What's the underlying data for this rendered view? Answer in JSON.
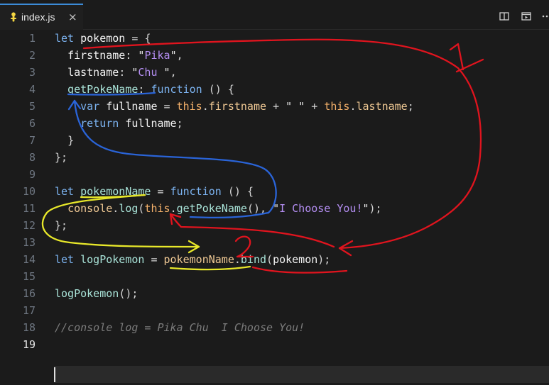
{
  "tab": {
    "filename": "index.js",
    "close": "×",
    "icon": "javascript-file-icon"
  },
  "actions": [
    {
      "icon": "split-editor-icon"
    },
    {
      "icon": "open-preview-icon"
    },
    {
      "icon": "more-actions-icon"
    }
  ],
  "gutter": {
    "lines": [
      "1",
      "2",
      "3",
      "4",
      "5",
      "6",
      "7",
      "8",
      "9",
      "10",
      "11",
      "12",
      "13",
      "14",
      "15",
      "16",
      "17",
      "18",
      "19"
    ],
    "active_line": "19"
  },
  "code": {
    "l1": [
      "let",
      "pokemon",
      "=",
      "{"
    ],
    "l2": [
      "firstname",
      ":",
      "\"",
      "Pika",
      "\"",
      ","
    ],
    "l3": [
      "lastname",
      ":",
      "\"",
      "Chu ",
      "\"",
      ","
    ],
    "l4": [
      "getPokeName",
      ":",
      "function",
      "()",
      "{"
    ],
    "l5": [
      "var",
      "fullname",
      "=",
      "this",
      ".",
      "firstname",
      "+",
      "\" \"",
      "+",
      "this",
      ".",
      "lastname",
      ";"
    ],
    "l6": [
      "return",
      "fullname",
      ";"
    ],
    "l7": [
      "}"
    ],
    "l8": [
      "};"
    ],
    "l10": [
      "let",
      "pokemonName",
      "=",
      "function",
      "()",
      "{"
    ],
    "l11": [
      "console",
      ".",
      "log",
      "(",
      "this",
      ".",
      "getPokeName",
      "()",
      ",",
      "\"",
      "I Choose You!",
      "\"",
      ");"
    ],
    "l12": [
      "};"
    ],
    "l14": [
      "let",
      "logPokemon",
      "=",
      "pokemonName",
      ".",
      "bind",
      "(",
      "pokemon",
      ");"
    ],
    "l16": [
      "logPokemon",
      "();"
    ],
    "l18": [
      "//console log = Pika Chu  I Choose You!"
    ]
  },
  "annotations": {
    "label_1": "1",
    "label_2": "2"
  },
  "colors": {
    "red": "#e0141e",
    "blue": "#2a64d8",
    "yellow": "#e8e82a",
    "tab_accent": "#3c8bd8"
  }
}
